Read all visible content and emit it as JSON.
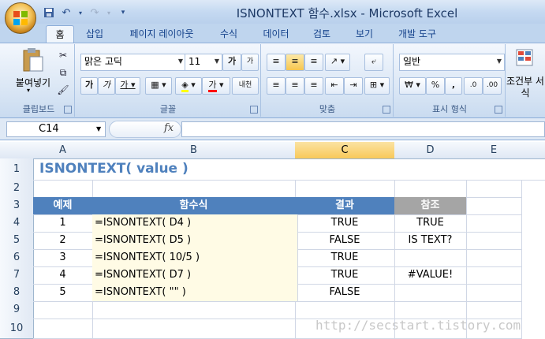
{
  "window": {
    "title": "ISNONTEXT 함수.xlsx - Microsoft Excel"
  },
  "qat": {
    "save_icon": "save-icon",
    "undo_icon": "undo-icon",
    "redo_icon": "redo-icon"
  },
  "tabs": [
    "홈",
    "삽입",
    "페이지 레이아웃",
    "수식",
    "데이터",
    "검토",
    "보기",
    "개발 도구"
  ],
  "ribbon": {
    "clipboard": {
      "paste_label": "붙여넣기",
      "group_label": "클립보드"
    },
    "font": {
      "font_name": "맑은 고딕",
      "font_size": "11",
      "bold": "가",
      "italic": "가",
      "underline": "가",
      "group_label": "글꼴",
      "grow": "가",
      "shrink": "가",
      "color_a": "가",
      "phonetic": "내천"
    },
    "alignment": {
      "group_label": "맞춤"
    },
    "number": {
      "format": "일반",
      "currency": "₩",
      "percent": "%",
      "comma": ",",
      "group_label": "표시 형식",
      "inc": ".0",
      "dec": ".00"
    },
    "styles": {
      "label": "조건부 서식"
    }
  },
  "formula_bar": {
    "name_box": "C14",
    "fx": "fx",
    "formula": ""
  },
  "columns": [
    "A",
    "B",
    "C",
    "D",
    "E"
  ],
  "rows": [
    "1",
    "2",
    "3",
    "4",
    "5",
    "6",
    "7",
    "8",
    "9",
    "10"
  ],
  "sheet": {
    "title": "ISNONTEXT( value )",
    "headers": {
      "a": "예제",
      "b": "함수식",
      "c": "결과",
      "d": "참조"
    },
    "data": [
      {
        "a": "1",
        "b": "=ISNONTEXT( D4 )",
        "c": "TRUE",
        "d": "TRUE"
      },
      {
        "a": "2",
        "b": "=ISNONTEXT( D5 )",
        "c": "FALSE",
        "d": "IS TEXT?"
      },
      {
        "a": "3",
        "b": "=ISNONTEXT( 10/5 )",
        "c": "TRUE",
        "d": ""
      },
      {
        "a": "4",
        "b": "=ISNONTEXT( D7 )",
        "c": "TRUE",
        "d": "#VALUE!"
      },
      {
        "a": "5",
        "b": "=ISNONTEXT( \"\" )",
        "c": "FALSE",
        "d": ""
      }
    ]
  },
  "watermark": "http://secstart.tistory.com",
  "colors": {
    "header_blue": "#4f81bd",
    "header_gray": "#a5a5a5",
    "title_blue": "#4f81bd"
  }
}
